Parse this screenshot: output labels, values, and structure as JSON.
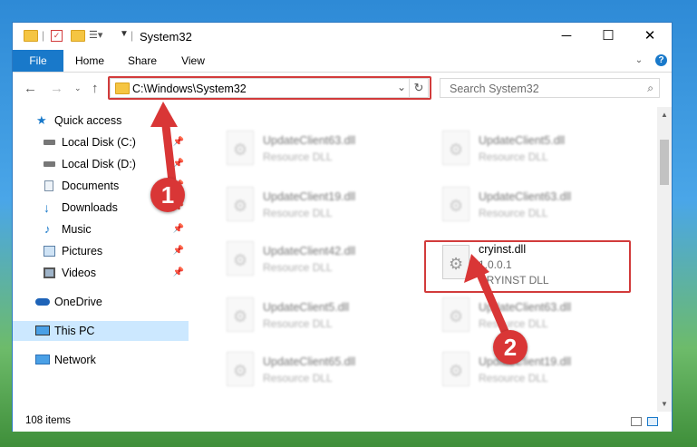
{
  "window": {
    "title": "System32"
  },
  "ribbon": {
    "tabs": [
      "File",
      "Home",
      "Share",
      "View"
    ]
  },
  "address": {
    "path": "C:\\Windows\\System32"
  },
  "search": {
    "placeholder": "Search System32"
  },
  "nav_pane": {
    "quick_access": "Quick access",
    "pinned": [
      {
        "label": "Local Disk (C:)",
        "icon": "drive-icon"
      },
      {
        "label": "Local Disk (D:)",
        "icon": "drive-icon"
      },
      {
        "label": "Documents",
        "icon": "documents-icon"
      },
      {
        "label": "Downloads",
        "icon": "downloads-icon"
      },
      {
        "label": "Music",
        "icon": "music-icon"
      },
      {
        "label": "Pictures",
        "icon": "pictures-icon"
      },
      {
        "label": "Videos",
        "icon": "videos-icon"
      }
    ],
    "onedrive": "OneDrive",
    "this_pc": "This PC",
    "network": "Network"
  },
  "files": [
    {
      "name": "UpdateClient63.dll",
      "type": "Resource DLL"
    },
    {
      "name": "UpdateClient5.dll",
      "type": "Resource DLL"
    },
    {
      "name": "UpdateClient19.dll",
      "type": "Resource DLL"
    },
    {
      "name": "UpdateClient63.dll",
      "type": "Resource DLL"
    },
    {
      "name": "UpdateClient42.dll",
      "type": "Resource DLL"
    },
    {
      "name": "cryinst.dll",
      "version": "1.0.0.1",
      "description": "CRYINST DLL"
    },
    {
      "name": "UpdateClient5.dll",
      "type": "Resource DLL"
    },
    {
      "name": "UpdateClient63.dll",
      "type": "Resource DLL"
    },
    {
      "name": "UpdateClient65.dll",
      "type": "Resource DLL"
    },
    {
      "name": "UpdateClient19.dll",
      "type": "Resource DLL"
    }
  ],
  "status": {
    "count": "108 items"
  },
  "annotations": {
    "step1": "1",
    "step2": "2"
  },
  "colors": {
    "highlight": "#d23b3b",
    "accent": "#1979ca",
    "selection": "#cce8ff"
  }
}
